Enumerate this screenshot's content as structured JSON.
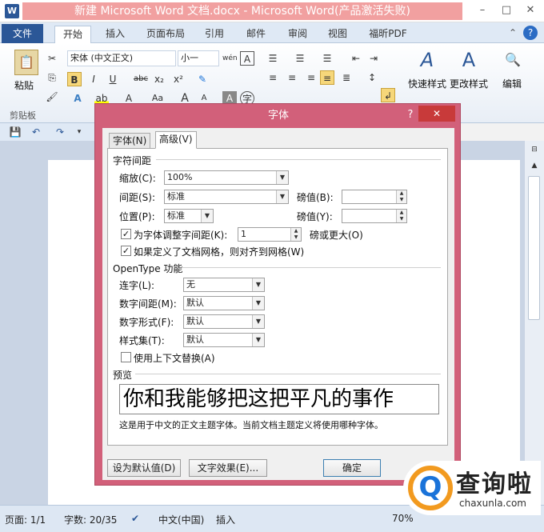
{
  "window": {
    "title": "新建 Microsoft Word 文档.docx - Microsoft Word(产品激活失败)",
    "word_logo": "W",
    "minimize": "–",
    "maximize": "□",
    "close": "✕"
  },
  "ribbon_tabs": {
    "file": "文件",
    "items": [
      "开始",
      "插入",
      "页面布局",
      "引用",
      "邮件",
      "审阅",
      "视图",
      "福昕PDF"
    ]
  },
  "ribbon": {
    "paste_label": "粘贴",
    "clipboard_label": "剪贴板",
    "font_name": "宋体 (中文正文)",
    "font_size": "小一",
    "phonetic": "wén",
    "char_border": "A",
    "bold": "B",
    "italic": "I",
    "underline": "U",
    "strike": "abc",
    "subscript": "x₂",
    "superscript": "x²",
    "case": "Aa",
    "grow": "A",
    "shrink": "A",
    "quick_styles": "快速样式",
    "change_styles": "更改样式",
    "editing": "编辑"
  },
  "dialog": {
    "title": "字体",
    "help": "?",
    "close": "✕",
    "tabs": [
      "字体(N)",
      "高级(V)"
    ],
    "char_spacing": {
      "section": "字符间距",
      "scale_label": "缩放(C):",
      "scale_value": "100%",
      "spacing_label": "间距(S):",
      "spacing_value": "标准",
      "spacing_pt_label": "磅值(B):",
      "position_label": "位置(P):",
      "position_value": "标准",
      "position_pt_label": "磅值(Y):",
      "kerning_label": "为字体调整字间距(K):",
      "kerning_value": "1",
      "kerning_suffix": "磅或更大(O)",
      "grid_label": "如果定义了文档网格，则对齐到网格(W)"
    },
    "opentype": {
      "section": "OpenType 功能",
      "ligatures_label": "连字(L):",
      "ligatures_value": "无",
      "num_spacing_label": "数字间距(M):",
      "num_spacing_value": "默认",
      "num_form_label": "数字形式(F):",
      "num_form_value": "默认",
      "style_set_label": "样式集(T):",
      "style_set_value": "默认",
      "contextual_label": "使用上下文替换(A)"
    },
    "preview": {
      "section": "预览",
      "text": "你和我能够把这把平凡的事作",
      "note": "这是用于中文的正文主题字体。当前文档主题定义将使用哪种字体。"
    },
    "buttons": {
      "set_default": "设为默认值(D)",
      "text_effects": "文字效果(E)...",
      "ok": "确定"
    }
  },
  "statusbar": {
    "page": "页面: 1/1",
    "words": "字数: 20/35",
    "language": "中文(中国)",
    "insert": "插入",
    "zoom": "70%"
  },
  "watermark": {
    "brand": "查询啦",
    "url": "chaxunla.com",
    "glyph": "Q"
  }
}
